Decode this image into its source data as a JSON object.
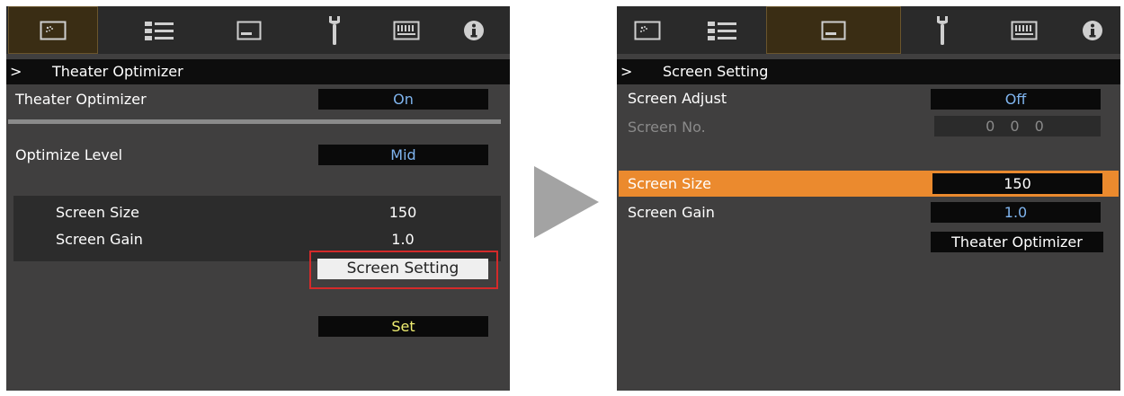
{
  "left": {
    "tabs": [
      {
        "icon": "picture-icon",
        "active": true
      },
      {
        "icon": "settings-list-icon",
        "active": false
      },
      {
        "icon": "display-icon",
        "active": false
      },
      {
        "icon": "wrench-icon",
        "active": false
      },
      {
        "icon": "grid-icon",
        "active": false
      },
      {
        "icon": "info-icon",
        "active": false
      }
    ],
    "breadcrumb_caret": ">",
    "title": "Theater Optimizer",
    "theater_optimizer": {
      "label": "Theater Optimizer",
      "value": "On"
    },
    "optimize_level": {
      "label": "Optimize Level",
      "value": "Mid"
    },
    "screen_size": {
      "label": "Screen Size",
      "value": "150"
    },
    "screen_gain": {
      "label": "Screen Gain",
      "value": "1.0"
    },
    "screen_setting_button": "Screen Setting",
    "set_button": "Set"
  },
  "right": {
    "tabs": [
      {
        "icon": "picture-icon",
        "active": false
      },
      {
        "icon": "settings-list-icon",
        "active": false
      },
      {
        "icon": "display-icon",
        "active": true
      },
      {
        "icon": "wrench-icon",
        "active": false
      },
      {
        "icon": "grid-icon",
        "active": false
      },
      {
        "icon": "info-icon",
        "active": false
      }
    ],
    "breadcrumb_caret": ">",
    "title": "Screen Setting",
    "screen_adjust": {
      "label": "Screen Adjust",
      "value": "Off"
    },
    "screen_no": {
      "label": "Screen No.",
      "value": "0 0 0"
    },
    "screen_size": {
      "label": "Screen Size",
      "value": "150"
    },
    "screen_gain": {
      "label": "Screen Gain",
      "value": "1.0"
    },
    "theater_optimizer_button": "Theater Optimizer"
  },
  "colors": {
    "panel_bg": "#403f3f",
    "active_tab": "#3a2d14",
    "value_blue": "#7fb4ee",
    "value_yellow": "#f1ef72",
    "selected_row": "#eb8a2e",
    "highlight_border": "#d52a2a",
    "arrow": "#a3a3a3"
  }
}
